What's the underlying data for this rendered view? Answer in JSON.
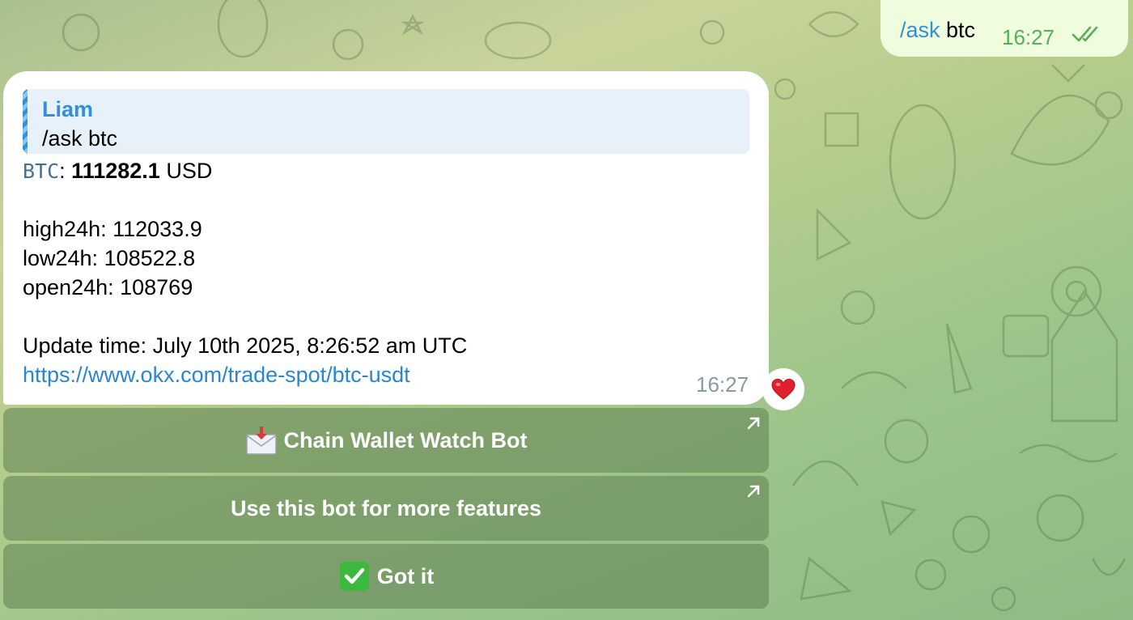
{
  "outgoing": {
    "command": "/ask",
    "argument": " btc",
    "time": "16:27",
    "status_icon": "double-check-icon",
    "status_color": "#5cad5a"
  },
  "incoming": {
    "reply": {
      "author": "Liam",
      "text": "/ask btc"
    },
    "price_line": {
      "symbol": "BTC",
      "separator": ": ",
      "price": "111282.1",
      "currency": " USD"
    },
    "stats": [
      "high24h: 112033.9",
      "low24h: 108522.8",
      "open24h: 108769"
    ],
    "update_time": "Update time: July 10th 2025, 8:26:52 am UTC",
    "link": "https://www.okx.com/trade-spot/btc-usdt",
    "time": "16:27",
    "reaction": "heart-icon"
  },
  "keyboard": {
    "buttons": [
      {
        "label": "Chain Wallet Watch Bot",
        "icon": "envelope-icon",
        "external": true
      },
      {
        "label": "Use this bot for more features",
        "icon": "",
        "external": true
      },
      {
        "label": "Got it",
        "icon": "check-mark-icon",
        "external": false
      }
    ]
  },
  "colors": {
    "accent": "#3390d6",
    "link": "#2a86d0",
    "bubble_out": "#effdde",
    "bubble_in": "#ffffff",
    "button_bg": "#5e8052"
  }
}
